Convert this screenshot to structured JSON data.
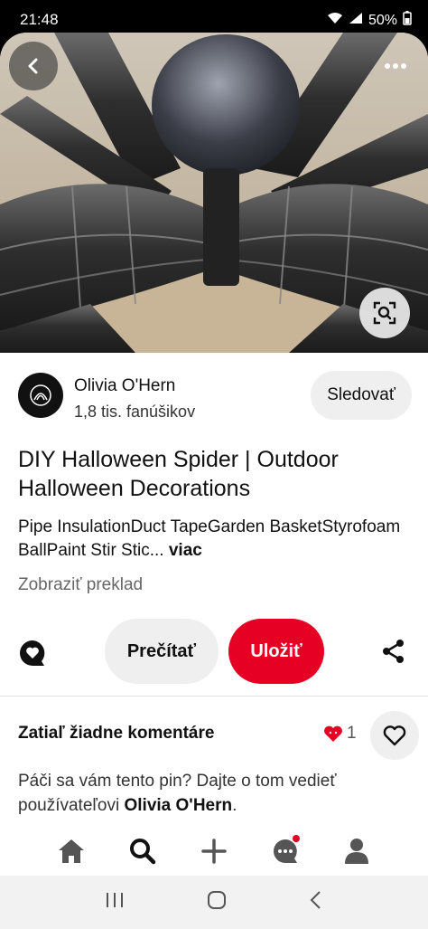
{
  "status_bar": {
    "time": "21:48",
    "battery": "50%"
  },
  "hero": {
    "description_icon_back": "back-arrow-icon",
    "more_icon": "more-dots-icon",
    "lens_icon": "visual-search-icon"
  },
  "creator": {
    "name": "Olivia O'Hern",
    "followers": "1,8 tis. fanúšikov",
    "follow_label": "Sledovať"
  },
  "pin": {
    "title": "DIY Halloween Spider | Outdoor Halloween Decorations",
    "description": "Pipe InsulationDuct TapeGarden BasketStyrofoam BallPaint Stir Stic...",
    "more_label": "viac",
    "translate_label": "Zobraziť preklad"
  },
  "actions": {
    "read_label": "Prečítať",
    "save_label": "Uložiť"
  },
  "comments": {
    "heading": "Zatiaľ žiadne komentáre",
    "reaction_count": "1",
    "prompt_prefix": "Páči sa vám tento pin? Dajte o tom vedieť používateľovi ",
    "prompt_user": "Olivia O'Hern",
    "prompt_suffix": "."
  },
  "colors": {
    "brand_red": "#e60023",
    "button_gray": "#efefef"
  },
  "bottom_nav": [
    "home-icon",
    "search-icon",
    "create-icon",
    "messages-icon",
    "profile-icon"
  ]
}
